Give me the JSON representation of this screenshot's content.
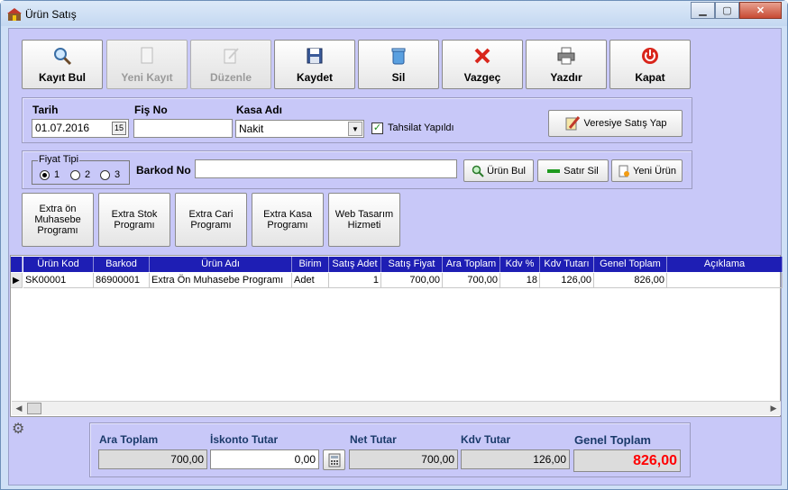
{
  "window": {
    "title": "Ürün Satış"
  },
  "toolbar": {
    "buttons": [
      {
        "label": "Kayıt Bul",
        "icon": "magnifier-icon",
        "enabled": true
      },
      {
        "label": "Yeni Kayıt",
        "icon": "new-document-icon",
        "enabled": false
      },
      {
        "label": "Düzenle",
        "icon": "edit-icon",
        "enabled": false
      },
      {
        "label": "Kaydet",
        "icon": "floppy-disk-icon",
        "enabled": true
      },
      {
        "label": "Sil",
        "icon": "trash-icon",
        "enabled": true
      },
      {
        "label": "Vazgeç",
        "icon": "red-x-icon",
        "enabled": true
      },
      {
        "label": "Yazdır",
        "icon": "printer-icon",
        "enabled": true
      },
      {
        "label": "Kapat",
        "icon": "power-icon",
        "enabled": true
      }
    ]
  },
  "header": {
    "date_label": "Tarih",
    "date_value": "01.07.2016",
    "fis_label": "Fiş No",
    "fis_value": "",
    "kasa_label": "Kasa Adı",
    "kasa_value": "Nakit",
    "tahsilat_label": "Tahsilat Yapıldı",
    "tahsilat_checked": true,
    "veresiye_label": "Veresiye Satış Yap"
  },
  "price": {
    "group_label": "Fiyat Tipi",
    "options": [
      "1",
      "2",
      "3"
    ],
    "selected": "1"
  },
  "barcode": {
    "label": "Barkod No",
    "value": ""
  },
  "actions": {
    "urun_bul": "Ürün Bul",
    "satir_sil": "Satır Sil",
    "yeni_urun": "Yeni Ürün"
  },
  "promos": [
    "Extra ön Muhasebe Programı",
    "Extra Stok Programı",
    "Extra Cari Programı",
    "Extra Kasa Programı",
    "Web Tasarım Hizmeti"
  ],
  "table": {
    "columns": [
      "Ürün Kod",
      "Barkod",
      "Ürün Adı",
      "Birim",
      "Satış Adet",
      "Satış Fiyat",
      "Ara Toplam",
      "Kdv %",
      "Kdv Tutarı",
      "Genel Toplam",
      "Açıklama"
    ],
    "rows": [
      [
        "SK00001",
        "86900001",
        "Extra Ön Muhasebe Programı",
        "Adet",
        "1",
        "700,00",
        "700,00",
        "18",
        "126,00",
        "826,00",
        ""
      ]
    ]
  },
  "totals": {
    "ara_label": "Ara Toplam",
    "ara_value": "700,00",
    "iskonto_label": "İskonto Tutar",
    "iskonto_value": "0,00",
    "net_label": "Net Tutar",
    "net_value": "700,00",
    "kdv_label": "Kdv Tutar",
    "kdv_value": "126,00",
    "genel_label": "Genel Toplam",
    "genel_value": "826,00"
  },
  "colors": {
    "panel": "#c8c8f8",
    "grid_header": "#1e1eb4",
    "genel_value": "#ff0000"
  }
}
